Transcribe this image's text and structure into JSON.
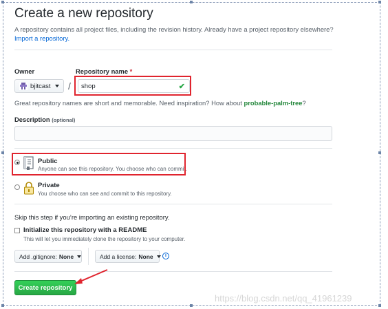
{
  "header": {
    "title": "Create a new repository",
    "intro_text": "A repository contains all project files, including the revision history. Already have a project repository elsewhere?",
    "import_link": "Import a repository."
  },
  "owner": {
    "label": "Owner",
    "value": "bjitcast"
  },
  "repository_name": {
    "label": "Repository name",
    "required_marker": "*",
    "value": "shop",
    "valid_icon": "check-icon"
  },
  "separator": "/",
  "name_hint": {
    "text": "Great repository names are short and memorable. Need inspiration? How about",
    "suggestion": "probable-palm-tree",
    "suffix": "?"
  },
  "description": {
    "label": "Description",
    "optional": "(optional)",
    "value": ""
  },
  "visibility": {
    "selected": "public",
    "public": {
      "title": "Public",
      "note": "Anyone can see this repository. You choose who can commit."
    },
    "private": {
      "title": "Private",
      "note": "You choose who can see and commit to this repository."
    }
  },
  "init": {
    "skip_text": "Skip this step if you’re importing an existing repository.",
    "readme_label": "Initialize this repository with a README",
    "readme_note": "This will let you immediately clone the repository to your computer.",
    "readme_checked": false,
    "gitignore_label": "Add .gitignore:",
    "gitignore_value": "None",
    "license_label": "Add a license:",
    "license_value": "None",
    "info_glyph": "i"
  },
  "create_button": "Create repository",
  "watermark": "https://blog.csdn.net/qq_41961239",
  "colors": {
    "accent_link": "#0366d6",
    "primary_button": "#28a745",
    "highlight": "#e0242e"
  }
}
